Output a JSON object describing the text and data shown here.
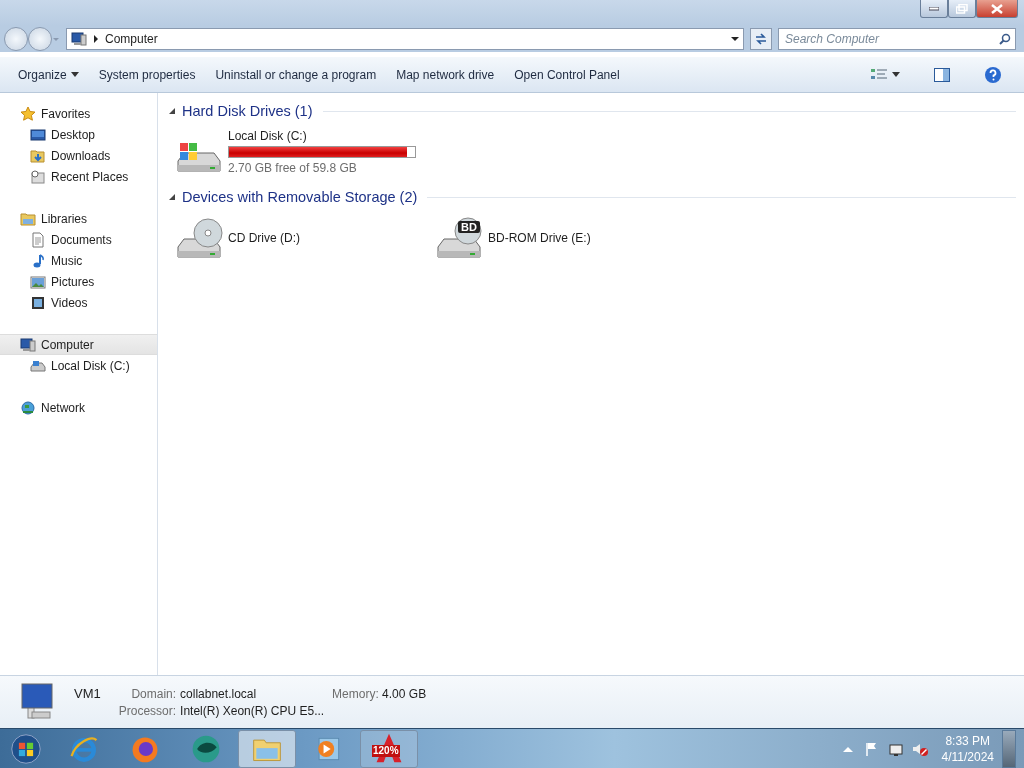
{
  "window": {
    "address": "Computer",
    "search": {
      "placeholder": "Search Computer"
    }
  },
  "toolbar": {
    "items": [
      {
        "label": "Organize",
        "kind": "menu"
      },
      {
        "label": "System properties",
        "kind": "plain"
      },
      {
        "label": "Uninstall or change a program",
        "kind": "plain"
      },
      {
        "label": "Map network drive",
        "kind": "plain"
      },
      {
        "label": "Open Control Panel",
        "kind": "plain"
      }
    ]
  },
  "sidebar": {
    "groups": [
      {
        "label": "Favorites",
        "kind": "star",
        "selected": false,
        "children": [
          {
            "label": "Desktop",
            "kind": "desktop",
            "selected": false
          },
          {
            "label": "Downloads",
            "kind": "downloads",
            "selected": false
          },
          {
            "label": "Recent Places",
            "kind": "recent",
            "selected": false
          }
        ]
      },
      {
        "label": "Libraries",
        "kind": "library",
        "selected": false,
        "children": [
          {
            "label": "Documents",
            "kind": "document",
            "selected": false
          },
          {
            "label": "Music",
            "kind": "music",
            "selected": false
          },
          {
            "label": "Pictures",
            "kind": "pictures",
            "selected": false
          },
          {
            "label": "Videos",
            "kind": "videos",
            "selected": false
          }
        ]
      },
      {
        "label": "Computer",
        "kind": "computer",
        "selected": true,
        "children": [
          {
            "label": "Local Disk (C:)",
            "kind": "disk",
            "selected": false
          }
        ]
      },
      {
        "label": "Network",
        "kind": "network",
        "selected": false
      }
    ]
  },
  "sections": [
    {
      "title": "Hard Disk Drives (1)",
      "expanded": true,
      "drives": [
        {
          "name": "Local Disk (C:)",
          "kind": "hdd",
          "level": 0.955,
          "info": "2.70 GB free of 59.8 GB"
        }
      ]
    },
    {
      "title": "Devices with Removable Storage (2)",
      "expanded": true,
      "drives": [
        {
          "name": "CD Drive (D:)",
          "kind": "cd"
        },
        {
          "name": "BD-ROM Drive (E:)",
          "kind": "bd",
          "badge": "BD"
        }
      ]
    }
  ],
  "details": {
    "name": "VM1",
    "fields": [
      {
        "label": "Domain:",
        "value": "collabnet.local"
      },
      {
        "label": "Memory:",
        "value": "4.00 GB"
      },
      {
        "label": "Processor:",
        "value": "Intel(R) Xeon(R) CPU E5..."
      }
    ]
  },
  "taskbar": {
    "items": [
      {
        "kind": "start",
        "open": false,
        "selected": false
      },
      {
        "kind": "browser-e",
        "open": false,
        "selected": false
      },
      {
        "kind": "fox",
        "open": false,
        "selected": false
      },
      {
        "kind": "teal",
        "open": false,
        "selected": false
      },
      {
        "kind": "folder",
        "open": true,
        "selected": true
      },
      {
        "kind": "media",
        "open": false,
        "selected": false
      },
      {
        "kind": "alcohol",
        "open": true,
        "selected": false,
        "label": "120%"
      }
    ],
    "time": "8:33 PM",
    "date": "4/11/2024"
  }
}
